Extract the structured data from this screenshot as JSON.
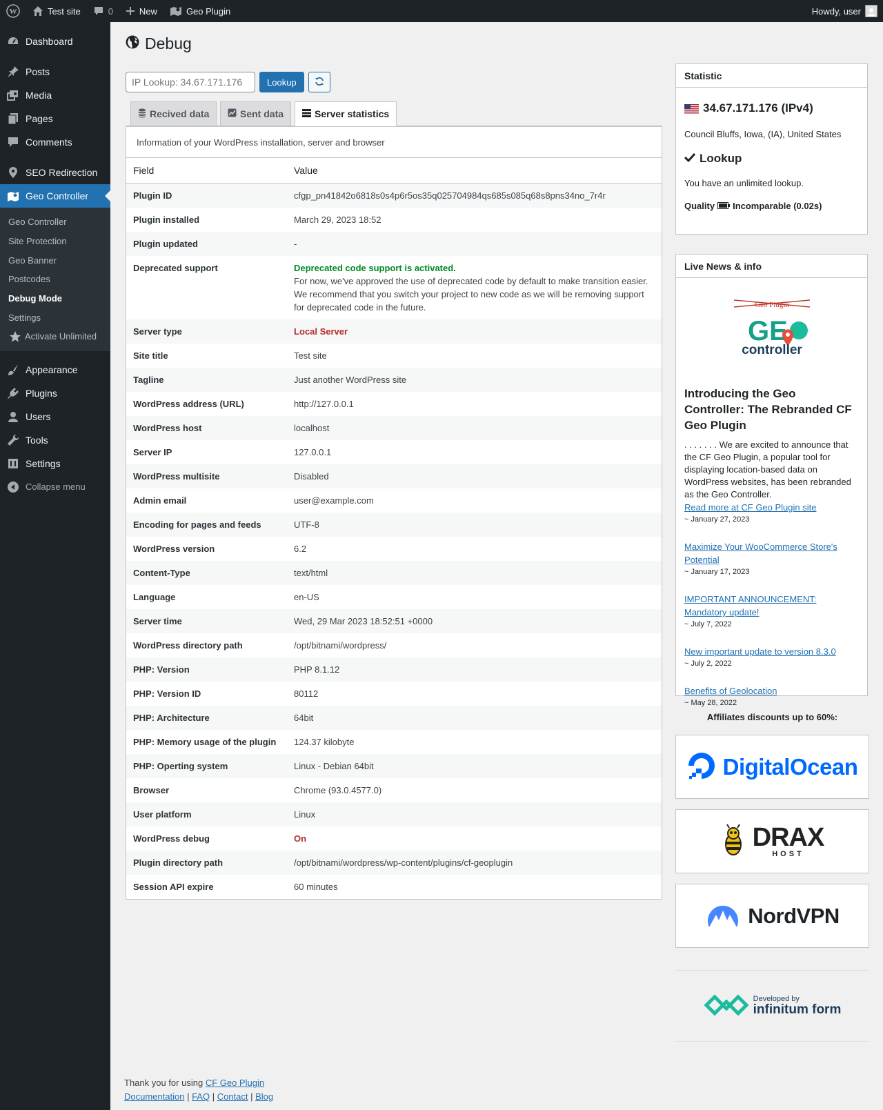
{
  "adminbar": {
    "site_name": "Test site",
    "comments_count": "0",
    "new_label": "New",
    "plugin_label": "Geo Plugin",
    "howdy": "Howdy, user"
  },
  "sidebar": {
    "items": [
      {
        "label": "Dashboard",
        "icon": "dashboard-icon"
      },
      {
        "label": "Posts",
        "icon": "pin-icon"
      },
      {
        "label": "Media",
        "icon": "media-icon"
      },
      {
        "label": "Pages",
        "icon": "pages-icon"
      },
      {
        "label": "Comments",
        "icon": "comment-icon"
      },
      {
        "label": "SEO Redirection",
        "icon": "location-icon"
      },
      {
        "label": "Geo Controller",
        "icon": "map-icon"
      },
      {
        "label": "Appearance",
        "icon": "brush-icon"
      },
      {
        "label": "Plugins",
        "icon": "plugin-icon"
      },
      {
        "label": "Users",
        "icon": "user-icon"
      },
      {
        "label": "Tools",
        "icon": "wrench-icon"
      },
      {
        "label": "Settings",
        "icon": "settings-icon"
      },
      {
        "label": "Collapse menu",
        "icon": "collapse-icon"
      }
    ],
    "submenu": [
      "Geo Controller",
      "Site Protection",
      "Geo Banner",
      "Postcodes",
      "Debug Mode",
      "Settings",
      "Activate Unlimited"
    ]
  },
  "page": {
    "title": "Debug",
    "lookup_placeholder": "IP Lookup: 34.67.171.176",
    "lookup_button": "Lookup",
    "tabs": [
      "Recived data",
      "Sent data",
      "Server statistics"
    ],
    "description": "Information of your WordPress installation, server and browser",
    "col_field": "Field",
    "col_value": "Value"
  },
  "rows": [
    {
      "field": "Plugin ID",
      "value": "cfgp_pn41842o6818s0s4p6r5os35q025704984qs685s085q68s8pns34no_7r4r"
    },
    {
      "field": "Plugin installed",
      "value": "March 29, 2023 18:52"
    },
    {
      "field": "Plugin updated",
      "value": "-"
    },
    {
      "field": "Deprecated support",
      "value_strong": "Deprecated code support is activated.",
      "value": "For now, we've approved the use of deprecated code by default to make transition easier. We recommend that you switch your project to new code as we will be removing support for deprecated code in the future."
    },
    {
      "field": "Server type",
      "value": "Local Server",
      "style": "red"
    },
    {
      "field": "Site title",
      "value": "Test site"
    },
    {
      "field": "Tagline",
      "value": "Just another WordPress site"
    },
    {
      "field": "WordPress address (URL)",
      "value": "http://127.0.0.1"
    },
    {
      "field": "WordPress host",
      "value": "localhost"
    },
    {
      "field": "Server IP",
      "value": "127.0.0.1"
    },
    {
      "field": "WordPress multisite",
      "value": "Disabled"
    },
    {
      "field": "Admin email",
      "value": "user@example.com"
    },
    {
      "field": "Encoding for pages and feeds",
      "value": "UTF-8"
    },
    {
      "field": "WordPress version",
      "value": "6.2"
    },
    {
      "field": "Content-Type",
      "value": "text/html"
    },
    {
      "field": "Language",
      "value": "en-US"
    },
    {
      "field": "Server time",
      "value": "Wed, 29 Mar 2023 18:52:51 +0000"
    },
    {
      "field": "WordPress directory path",
      "value": "/opt/bitnami/wordpress/"
    },
    {
      "field": "PHP: Version",
      "value": "PHP 8.1.12"
    },
    {
      "field": "PHP: Version ID",
      "value": "80112"
    },
    {
      "field": "PHP: Architecture",
      "value": "64bit"
    },
    {
      "field": "PHP: Memory usage of the plugin",
      "value": "124.37 kilobyte"
    },
    {
      "field": "PHP: Operting system",
      "value": "Linux - Debian 64bit"
    },
    {
      "field": "Browser",
      "value": "Chrome (93.0.4577.0)"
    },
    {
      "field": "User platform",
      "value": "Linux"
    },
    {
      "field": "WordPress debug",
      "value": "On",
      "style": "red"
    },
    {
      "field": "Plugin directory path",
      "value": "/opt/bitnami/wordpress/wp-content/plugins/cf-geoplugin"
    },
    {
      "field": "Session API expire",
      "value": "60 minutes"
    }
  ],
  "statistic": {
    "title": "Statistic",
    "ip": "34.67.171.176 (IPv4)",
    "location": "Council Bluffs, Iowa, (IA), United States",
    "lookup_heading": "Lookup",
    "lookup_text": "You have an unlimited lookup.",
    "quality_label": "Quality",
    "quality_value": "Incomparable (0.02s)"
  },
  "news": {
    "title": "Live News & info",
    "logo_old": "Geo Plugin",
    "logo_top": "GE",
    "logo_bottom": "controller",
    "headline": "Introducing the Geo Controller: The Rebranded CF Geo Plugin",
    "text": ". . . . . . . We are excited to announce that the CF Geo Plugin, a popular tool for displaying location-based data on WordPress websites, has been rebranded as the Geo Controller.",
    "read_more": "Read more at CF Geo Plugin site",
    "date": "~ January 27, 2023",
    "items": [
      {
        "title": "Maximize Your WooCommerce Store's Potential",
        "date": "~ January 17, 2023"
      },
      {
        "title": "IMPORTANT ANNOUNCEMENT: Mandatory update!",
        "date": "~ July 7, 2022"
      },
      {
        "title": "New important update to version 8.3.0",
        "date": "~ July 2, 2022"
      },
      {
        "title": "Benefits of Geolocation",
        "date": "~ May 28, 2022"
      }
    ]
  },
  "affiliates": {
    "title": "Affiliates discounts up to 60%:",
    "digitalocean": "DigitalOcean",
    "draxhost": "DRAX",
    "draxhost_sub": "HOST",
    "nordvpn": "NordVPN",
    "developed_by": "Developed by",
    "infinitum": "infinitum form"
  },
  "footer": {
    "thanks": "Thank you for using",
    "plugin_link": "CF Geo Plugin",
    "links": [
      "Documentation",
      "FAQ",
      "Contact",
      "Blog"
    ]
  },
  "colors": {
    "accent": "#2271b1",
    "sidebar": "#1d2327",
    "green": "#008a20",
    "red": "#b32d2e"
  }
}
